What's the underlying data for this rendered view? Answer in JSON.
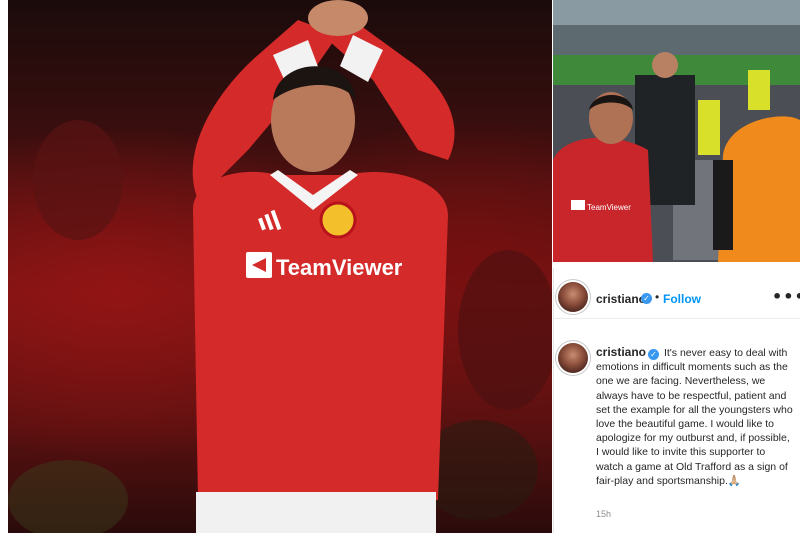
{
  "main_photo": {
    "jersey_sponsor_text": "TeamViewer",
    "jersey_brand": "adidas"
  },
  "thumbnail": {
    "sponsor_text": "TeamViewer"
  },
  "post": {
    "username": "cristiano",
    "verified_symbol": "✓",
    "separator": "•",
    "follow_label": "Follow",
    "more_symbol": "•••",
    "caption_text": "It's never easy to deal with emotions in difficult moments such as the one we are facing. Nevertheless, we always have to be respectful, patient and set the example for all the youngsters who love the beautiful game. I would like to apologize for my outburst and, if possible, I would like to invite this supporter to watch a game at Old Trafford as a sign of fair-play and sportsmanship.🙏🏼",
    "timestamp": "15h"
  },
  "colors": {
    "jersey_red": "#d42a2a",
    "link_blue": "#0095f6",
    "verified_blue": "#3897f0",
    "text_dark": "#262626",
    "text_muted": "#8e8e8e"
  }
}
